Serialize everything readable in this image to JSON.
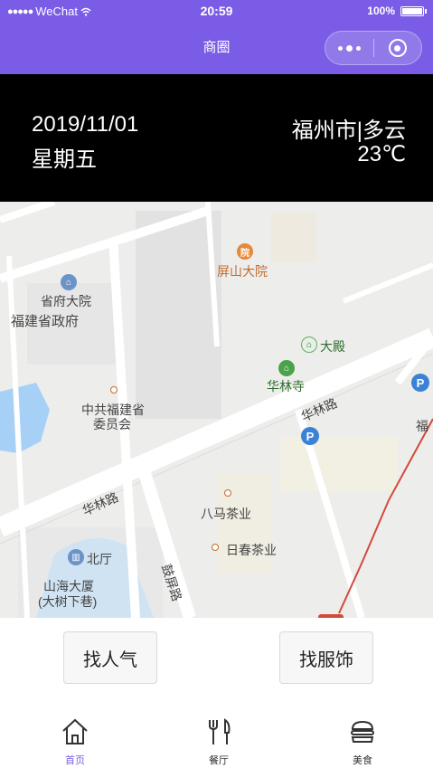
{
  "status_bar": {
    "carrier": "WeChat",
    "signal_dots": "●●●●●",
    "time": "20:59",
    "battery": "100%"
  },
  "nav": {
    "title": "商圈"
  },
  "info": {
    "date": "2019/11/01",
    "weekday": "星期五",
    "city_weather": "福州市|多云",
    "temperature": "23℃"
  },
  "map": {
    "labels": {
      "pingshan": "屏山大院",
      "shengfu_dayuan": "省府大院",
      "fujian_govt": "福建省政府",
      "dadian": "大殿",
      "hualinsi": "华林寺",
      "party_committee_1": "中共福建省",
      "party_committee_2": "委员会",
      "hualin_road_1": "华林路",
      "hualin_road_2": "华林路",
      "bama_tea": "八马茶业",
      "richun_tea": "日春茶业",
      "beiting": "北厅",
      "shanhai_1": "山海大厦",
      "shanhai_2": "(大树下巷)",
      "gu_ping_road": "鼓屏路",
      "fujian_edge": "福"
    },
    "colors": {
      "road": "#ffffff",
      "water": "#a7d0f7",
      "block": "#e1e1e1",
      "route": "#d24a3a"
    }
  },
  "buttons": {
    "popular": "找人气",
    "clothing": "找服饰"
  },
  "tabs": [
    {
      "label": "首页",
      "icon": "home-icon",
      "active": true
    },
    {
      "label": "餐厅",
      "icon": "restaurant-icon",
      "active": false
    },
    {
      "label": "美食",
      "icon": "burger-icon",
      "active": false
    }
  ],
  "accent": "#7b5ce6"
}
